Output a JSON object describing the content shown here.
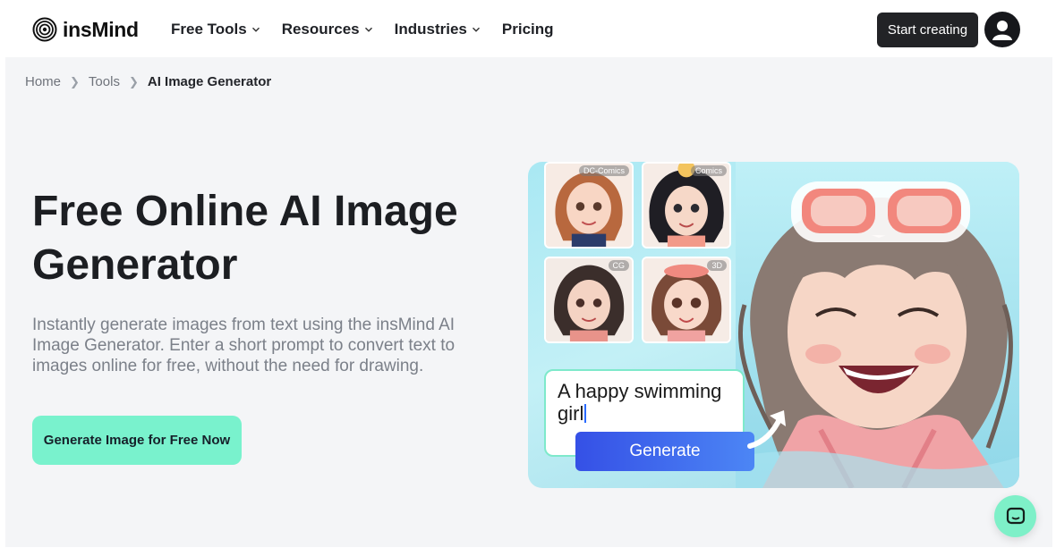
{
  "brand": {
    "name": "insMind"
  },
  "nav": {
    "items": [
      {
        "label": "Free Tools",
        "has_dropdown": true
      },
      {
        "label": "Resources",
        "has_dropdown": true
      },
      {
        "label": "Industries",
        "has_dropdown": true
      },
      {
        "label": "Pricing",
        "has_dropdown": false
      }
    ]
  },
  "header": {
    "start_label": "Start creating"
  },
  "breadcrumb": {
    "items": [
      "Home",
      "Tools",
      "AI Image Generator"
    ]
  },
  "hero": {
    "title": "Free Online AI Image Generator",
    "description": "Instantly generate images from text using the insMind AI Image Generator. Enter a short prompt to convert text to images online for free, without the need for drawing.",
    "cta_label": "Generate Image for Free Now"
  },
  "showcase": {
    "styles": [
      "DC-Comics",
      "Comics",
      "CG",
      "3D"
    ],
    "prompt": "A happy swimming girl",
    "generate_label": "Generate"
  },
  "colors": {
    "accent": "#79f2cd",
    "dark": "#222326",
    "generate": "#3f6cee"
  },
  "icons": [
    "logo-mark-icon",
    "chevron-down-icon",
    "user-icon",
    "arrow-icon",
    "chat-icon"
  ]
}
